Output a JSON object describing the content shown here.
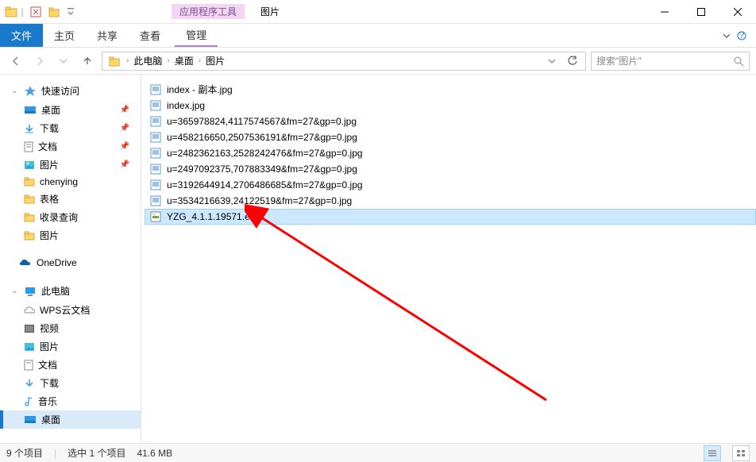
{
  "titlebar": {
    "app_tools_label": "应用程序工具",
    "image_title": "图片"
  },
  "ribbon": {
    "file_label": "文件",
    "home_label": "主页",
    "share_label": "共享",
    "view_label": "查看",
    "manage_label": "管理"
  },
  "addrbar": {
    "crumb1": "此电脑",
    "crumb2": "桌面",
    "crumb3": "图片",
    "search_placeholder": "搜索\"图片\""
  },
  "navpane": {
    "quick_access": "快速访问",
    "desktop": "桌面",
    "downloads": "下载",
    "documents": "文档",
    "pictures": "图片",
    "chenying": "chenying",
    "tables": "表格",
    "records": "收录查询",
    "pictures2": "图片",
    "onedrive": "OneDrive",
    "this_pc": "此电脑",
    "wps": "WPS云文档",
    "videos": "视频",
    "pictures3": "图片",
    "documents2": "文档",
    "downloads2": "下载",
    "music": "音乐",
    "desktop2": "桌面"
  },
  "files": [
    "index - 副本.jpg",
    "index.jpg",
    "u=365978824,4117574567&fm=27&gp=0.jpg",
    "u=458216650,2507536191&fm=27&gp=0.jpg",
    "u=2482362163,2528242476&fm=27&gp=0.jpg",
    "u=2497092375,707883349&fm=27&gp=0.jpg",
    "u=3192644914,2706486685&fm=27&gp=0.jpg",
    "u=3534216639,24122519&fm=27&gp=0.jpg",
    "YZG_4.1.1.19571.exe"
  ],
  "status": {
    "count": "9 个项目",
    "selected": "选中 1 个项目",
    "size": "41.6 MB"
  }
}
